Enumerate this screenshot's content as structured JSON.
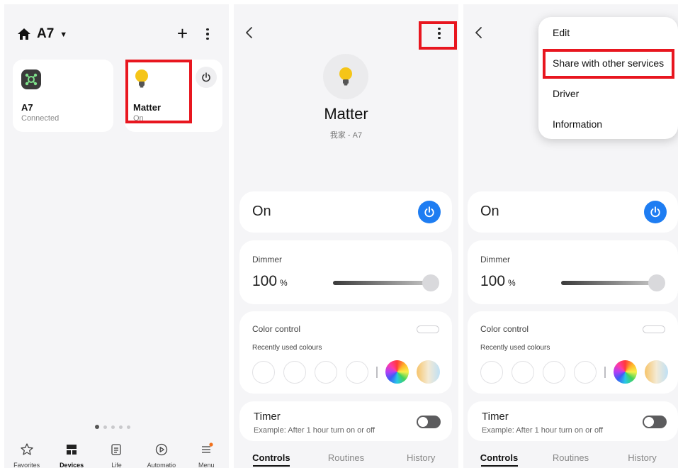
{
  "home": {
    "location": "A7",
    "devices": [
      {
        "name": "A7",
        "status": "Connected"
      },
      {
        "name": "Matter",
        "status": "On"
      }
    ],
    "nav": [
      {
        "label": "Favorites",
        "icon": "star-icon"
      },
      {
        "label": "Devices",
        "icon": "devices-icon",
        "active": true
      },
      {
        "label": "Life",
        "icon": "life-icon"
      },
      {
        "label": "Automatio",
        "icon": "automation-icon"
      },
      {
        "label": "Menu",
        "icon": "menu-icon"
      }
    ]
  },
  "device": {
    "title": "Matter",
    "subtitle": "我家 - A7",
    "state": "On",
    "dimmer_label": "Dimmer",
    "dimmer_value": "100",
    "dimmer_unit": "%",
    "dimmer_level": 1.0,
    "color_label": "Color control",
    "recent_colours_label": "Recently used colours",
    "timer_title": "Timer",
    "timer_example": "Example: After 1 hour turn on or off",
    "tabs": [
      "Controls",
      "Routines",
      "History"
    ]
  },
  "menu": {
    "items": [
      "Edit",
      "Share with other services",
      "Driver",
      "Information"
    ]
  },
  "colors": {
    "accent_blue": "#1e7df2",
    "highlight_red": "#e8161f",
    "bulb_yellow": "#f5c518",
    "panel_bg": "#f5f5f7"
  }
}
